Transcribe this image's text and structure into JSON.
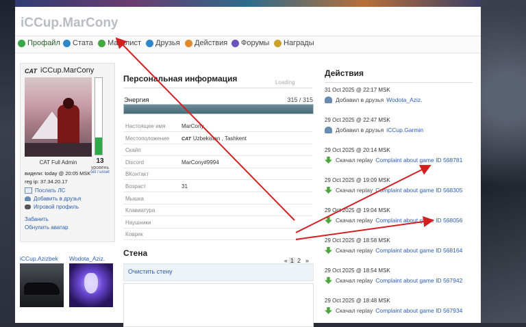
{
  "site": {
    "title": "iCCup.MarCony"
  },
  "nav": [
    {
      "label": "Профайл",
      "color": "#3aa64a"
    },
    {
      "label": "Стата",
      "color": "#2f86c9"
    },
    {
      "label": "Матчлист",
      "color": "#43a83f"
    },
    {
      "label": "Друзья",
      "color": "#2f86c9"
    },
    {
      "label": "Действия",
      "color": "#e08a2a"
    },
    {
      "label": "Форумы",
      "color": "#6a52b8"
    },
    {
      "label": "Награды",
      "color": "#c9a12b"
    }
  ],
  "profile": {
    "clan_tag": "CAT",
    "name": "iCCup.MarCony",
    "energy_fraction": 0.22,
    "rank": "CAT Full Admin",
    "level": "13",
    "level_word": "уровень",
    "level_link": "set / unset",
    "seen": "видели: today @ 20:05 MSK",
    "reg_ip": "reg ip: 37.34.20.17",
    "links": {
      "message": "Послать ЛС",
      "add_friend": "Добавить в друзья",
      "game_profile": "Игровой профиль",
      "ban": "Забанить",
      "update_avatar": "Обнулить аватар"
    }
  },
  "friends": [
    {
      "name": "iCCup.Azizbek"
    },
    {
      "name": "Wodota_Aziz."
    }
  ],
  "info": {
    "title": "Персональная информация",
    "loading": "Loading",
    "energy_label": "Энергия",
    "energy_value": "315 / 315",
    "energy_fraction": 1.0,
    "rows": [
      {
        "label": "Настоящее имя",
        "value": "MarCony"
      },
      {
        "label": "Местоположение",
        "value": "Uzbekistan , Tashkent",
        "tag": "CAT"
      },
      {
        "label": "Скайп",
        "value": ""
      },
      {
        "label": "Discord",
        "value": "MarCony#9994"
      },
      {
        "label": "ВКонтакт",
        "value": ""
      },
      {
        "label": "Возраст",
        "value": "31"
      },
      {
        "label": "Мышка",
        "value": ""
      },
      {
        "label": "Клавиатура",
        "value": ""
      },
      {
        "label": "Наушники",
        "value": ""
      },
      {
        "label": "Коврик",
        "value": ""
      }
    ]
  },
  "wall": {
    "title": "Стена",
    "pager": {
      "prev": "«",
      "current": "1",
      "next_page": "2",
      "next": "»"
    },
    "clear": "Очистить стену"
  },
  "actions": {
    "title": "Действия",
    "items": [
      {
        "time": "31 Oct 2025 @ 22:17 MSK",
        "text": "Добавил в друзья",
        "link": "Wodota_Aziz.",
        "kind": "friend"
      },
      {
        "time": "29 Oct 2025 @ 22:47 MSK",
        "text": "Добавил в друзья",
        "link": "iCCup.Garmin",
        "kind": "friend"
      },
      {
        "time": "29 Oct 2025 @ 20:14 MSK",
        "text": "Скачал replay",
        "link": "Complaint about game ID 568781",
        "kind": "download"
      },
      {
        "time": "29 Oct 2025 @ 19:09 MSK",
        "text": "Скачал replay",
        "link": "Complaint about game ID 568305",
        "kind": "download"
      },
      {
        "time": "29 Oct 2025 @ 19:04 MSK",
        "text": "Скачал replay",
        "link": "Complaint about game ID 568056",
        "kind": "download"
      },
      {
        "time": "29 Oct 2025 @ 18:58 MSK",
        "text": "Скачал replay",
        "link": "Complaint about game ID 568164",
        "kind": "download"
      },
      {
        "time": "29 Oct 2025 @ 18:54 MSK",
        "text": "Скачал replay",
        "link": "Complaint about game ID 567942",
        "kind": "download"
      },
      {
        "time": "29 Oct 2025 @ 18:48 MSK",
        "text": "Скачал replay",
        "link": "Complaint about game ID 567934",
        "kind": "download"
      }
    ]
  },
  "annotation_color": "#d21f1f"
}
